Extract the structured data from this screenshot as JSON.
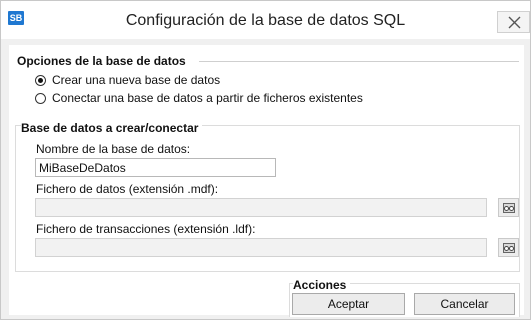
{
  "window": {
    "title": "Configuración de la base de datos SQL",
    "app_icon_text": "SB",
    "close_icon": "close-icon"
  },
  "db_options": {
    "heading": "Opciones de la base de datos",
    "create_new_label": "Crear una nueva base de datos",
    "connect_existing_label": "Conectar una base de datos a partir de ficheros existentes",
    "selected": "create_new"
  },
  "db_target": {
    "heading": "Base de datos a crear/conectar",
    "name_label": "Nombre de la base de datos:",
    "name_value": "MiBaseDeDatos",
    "data_file_label": "Fichero de datos (extensión .mdf):",
    "data_file_value": "",
    "log_file_label": "Fichero de transacciones (extensión .ldf):",
    "log_file_value": "",
    "browse_icon": "browse-files-icon"
  },
  "actions": {
    "heading": "Acciones",
    "accept_label": "Aceptar",
    "cancel_label": "Cancelar"
  }
}
